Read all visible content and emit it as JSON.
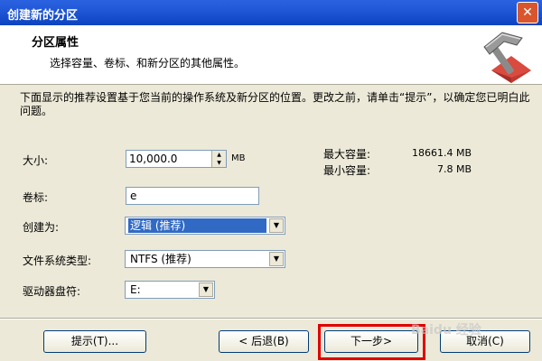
{
  "window": {
    "title": "创建新的分区"
  },
  "header": {
    "title": "分区属性",
    "subtitle": "选择容量、卷标、和新分区的其他属性。",
    "icon": "hammer-icon"
  },
  "description": "下面显示的推荐设置基于您当前的操作系统及新分区的位置。更改之前，请单击“提示”，以确定您已明白此问题。",
  "fields": {
    "size_label": "大小:",
    "size_value": "10,000.0",
    "size_unit": "MB",
    "volume_label_label": "卷标:",
    "volume_label_value": "e",
    "create_as_label": "创建为:",
    "create_as_value": "逻辑 (推荐)",
    "fs_type_label": "文件系统类型:",
    "fs_type_value": "NTFS (推荐)",
    "drive_letter_label": "驱动器盘符:",
    "drive_letter_value": "E:"
  },
  "capacity": {
    "max_label": "最大容量:",
    "max_value": "18661.4 MB",
    "min_label": "最小容量:",
    "min_value": "7.8 MB"
  },
  "buttons": {
    "hint": "提示(T)...",
    "back": "< 后退(B)",
    "next": "下一步>",
    "cancel": "取消(C)"
  },
  "watermark": "Baidu 经验",
  "colors": {
    "highlight": "#e00000",
    "selection": "#316ac5"
  }
}
